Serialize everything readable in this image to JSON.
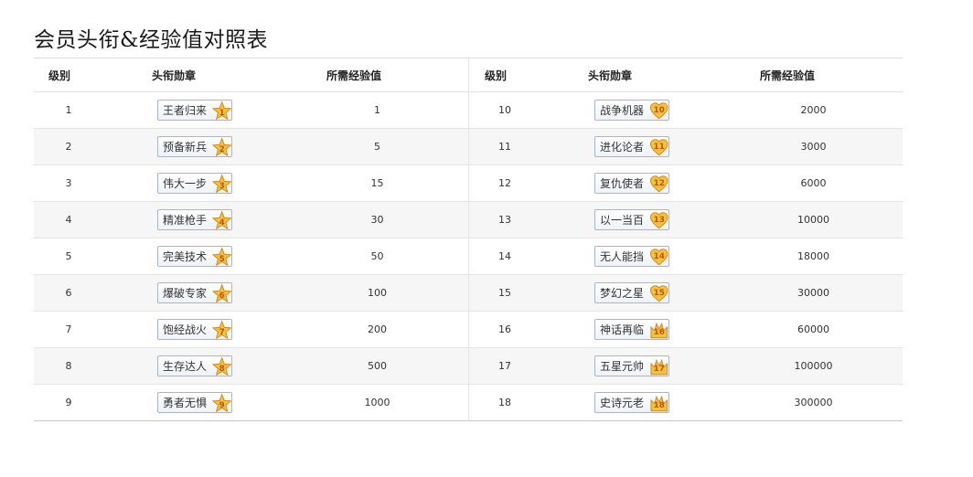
{
  "page": {
    "title": "会员头衔&经验值对照表"
  },
  "table": {
    "headers": {
      "level": "级别",
      "medal": "头衔勋章",
      "exp": "所需经验值"
    },
    "left_rows": [
      {
        "level": "1",
        "title": "王者归来",
        "badge": "1",
        "badge_icon": "star-badge-icon",
        "exp": "1"
      },
      {
        "level": "2",
        "title": "预备新兵",
        "badge": "2",
        "badge_icon": "star-badge-icon",
        "exp": "5"
      },
      {
        "level": "3",
        "title": "伟大一步",
        "badge": "3",
        "badge_icon": "star-badge-icon",
        "exp": "15"
      },
      {
        "level": "4",
        "title": "精准枪手",
        "badge": "4",
        "badge_icon": "star-badge-icon",
        "exp": "30"
      },
      {
        "level": "5",
        "title": "完美技术",
        "badge": "5",
        "badge_icon": "star-badge-icon",
        "exp": "50"
      },
      {
        "level": "6",
        "title": "爆破专家",
        "badge": "6",
        "badge_icon": "star-badge-icon",
        "exp": "100"
      },
      {
        "level": "7",
        "title": "饱经战火",
        "badge": "7",
        "badge_icon": "star-badge-icon",
        "exp": "200"
      },
      {
        "level": "8",
        "title": "生存达人",
        "badge": "8",
        "badge_icon": "star-badge-icon",
        "exp": "500"
      },
      {
        "level": "9",
        "title": "勇者无惧",
        "badge": "9",
        "badge_icon": "star-badge-icon",
        "exp": "1000"
      }
    ],
    "right_rows": [
      {
        "level": "10",
        "title": "战争机器",
        "badge": "10",
        "badge_icon": "heart-badge-icon",
        "exp": "2000"
      },
      {
        "level": "11",
        "title": "进化论者",
        "badge": "11",
        "badge_icon": "heart-badge-icon",
        "exp": "3000"
      },
      {
        "level": "12",
        "title": "复仇使者",
        "badge": "12",
        "badge_icon": "heart-badge-icon",
        "exp": "6000"
      },
      {
        "level": "13",
        "title": "以一当百",
        "badge": "13",
        "badge_icon": "heart-badge-icon",
        "exp": "10000"
      },
      {
        "level": "14",
        "title": "无人能挡",
        "badge": "14",
        "badge_icon": "heart-badge-icon",
        "exp": "18000"
      },
      {
        "level": "15",
        "title": "梦幻之星",
        "badge": "15",
        "badge_icon": "heart-badge-icon",
        "exp": "30000"
      },
      {
        "level": "16",
        "title": "神话再临",
        "badge": "16",
        "badge_icon": "crown-badge-icon",
        "exp": "60000"
      },
      {
        "level": "17",
        "title": "五星元帅",
        "badge": "17",
        "badge_icon": "crown-badge-icon",
        "exp": "100000"
      },
      {
        "level": "18",
        "title": "史诗元老",
        "badge": "18",
        "badge_icon": "crown-badge-icon",
        "exp": "300000"
      }
    ]
  },
  "colors": {
    "badge_gold": "#f5c23a",
    "badge_outline": "#d18a1c",
    "badge_text": "#c2521a",
    "medal_border": "#9fb7d8",
    "row_alt": "#f6f6f6"
  }
}
